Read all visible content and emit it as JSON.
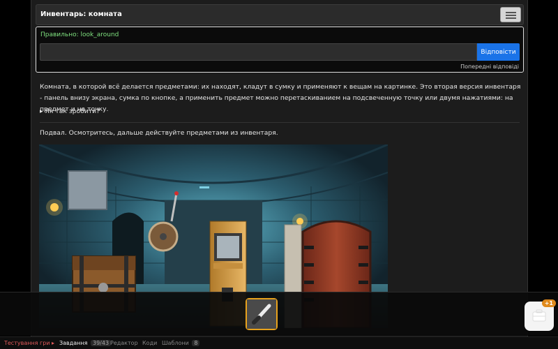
{
  "panel": {
    "title": "Инвентарь: комната"
  },
  "answer": {
    "correct_label": "Правильно: look_around",
    "input_value": "",
    "input_placeholder": "",
    "submit_label": "Відповісти",
    "previous_answers_label": "Попередні відповіді"
  },
  "description": "Комната, в которой всё делается предметами: их находят, кладут в сумку и применяют к вещам на картинке. Это вторая версия инвентаря - панель внизу экрана, сумка по кнопке, а применить предмет можно перетаскиванием на подсвеченную точку или двумя нажатиями: на предмет и на точку.",
  "howto_label": "▸ Як так зробити?",
  "scene_text": "Подвал. Осмотритесь, дальше действуйте предметами из инвентаря.",
  "inventory": {
    "bag_badge": "+1"
  },
  "statusbar": {
    "test_label": "Тестування гри ▸",
    "tasks_label": "Завдання",
    "tasks_count": "39/43",
    "editor_label": "Редактор",
    "codes_label": "Коди",
    "templates_label": "Шаблони",
    "templates_count": "8"
  }
}
